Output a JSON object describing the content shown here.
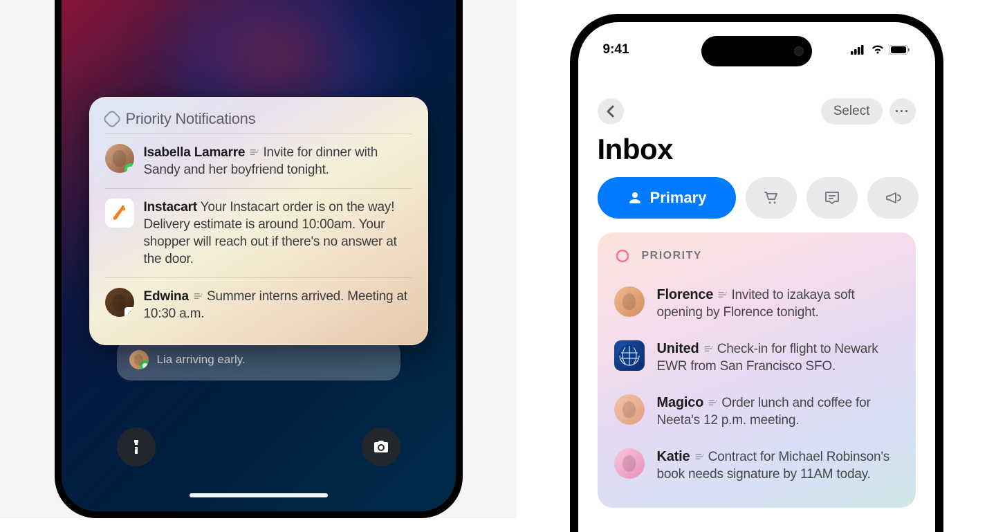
{
  "lockscreen": {
    "priority_title": "Priority Notifications",
    "notifications": [
      {
        "sender": "Isabella Lamarre",
        "message": "Invite for dinner with Sandy and her boyfriend tonight.",
        "app": "messages"
      },
      {
        "sender": "Instacart",
        "message": "Your Instacart order is on the way! Delivery estimate is around 10:00am. Your shopper will reach out if there's no answer at the door.",
        "app": "instacart"
      },
      {
        "sender": "Edwina",
        "message": "Summer interns arrived. Meeting at 10:30 a.m.",
        "app": "slack"
      }
    ],
    "behind_text": "Lia arriving early."
  },
  "mail": {
    "status_time": "9:41",
    "select_label": "Select",
    "inbox_title": "Inbox",
    "primary_label": "Primary",
    "priority_section_label": "PRIORITY",
    "items": [
      {
        "sender": "Florence",
        "summary": "Invited to izakaya soft opening by Florence tonight."
      },
      {
        "sender": "United",
        "summary": "Check-in for flight to Newark EWR from San Francisco SFO."
      },
      {
        "sender": "Magico",
        "summary": "Order lunch and coffee for Neeta's 12 p.m. meeting."
      },
      {
        "sender": "Katie",
        "summary": "Contract for Michael Robinson's book needs signature by 11AM today."
      }
    ]
  }
}
